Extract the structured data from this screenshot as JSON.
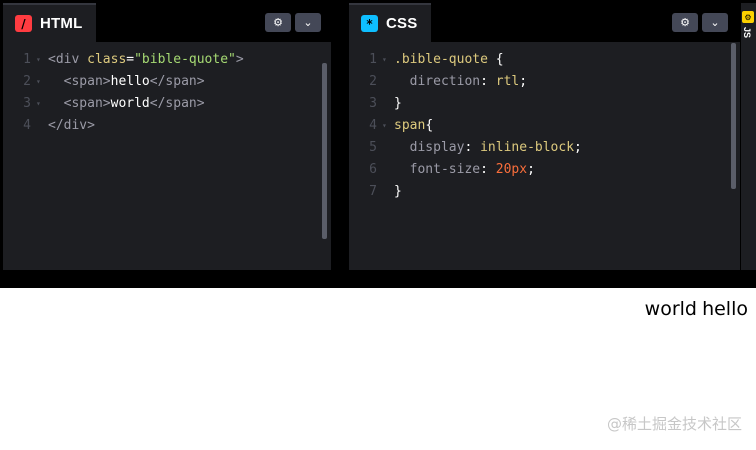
{
  "panes": {
    "html": {
      "label": "HTML",
      "icon": "/",
      "lines": [
        {
          "num": "1",
          "fold": "▾",
          "tokens": [
            {
              "c": "t-tag",
              "t": "<div "
            },
            {
              "c": "t-attr",
              "t": "class"
            },
            {
              "c": "t-punc",
              "t": "="
            },
            {
              "c": "t-str",
              "t": "\"bible-quote\""
            },
            {
              "c": "t-tag",
              "t": ">"
            }
          ]
        },
        {
          "num": "2",
          "fold": "▾",
          "tokens": [
            {
              "c": "t-tag",
              "t": "  <span>"
            },
            {
              "c": "t-text",
              "t": "hello"
            },
            {
              "c": "t-tag",
              "t": "</span>"
            }
          ]
        },
        {
          "num": "3",
          "fold": "▾",
          "tokens": [
            {
              "c": "t-tag",
              "t": "  <span>"
            },
            {
              "c": "t-text",
              "t": "world"
            },
            {
              "c": "t-tag",
              "t": "</span>"
            }
          ]
        },
        {
          "num": "4",
          "fold": "",
          "tokens": [
            {
              "c": "t-tag",
              "t": "</div>"
            }
          ]
        }
      ]
    },
    "css": {
      "label": "CSS",
      "icon": "*",
      "lines": [
        {
          "num": "1",
          "fold": "▾",
          "tokens": [
            {
              "c": "t-sel",
              "t": ".bible-quote "
            },
            {
              "c": "t-punc",
              "t": "{"
            }
          ]
        },
        {
          "num": "2",
          "fold": "",
          "tokens": [
            {
              "c": "t-prop",
              "t": "  direction"
            },
            {
              "c": "t-punc",
              "t": ": "
            },
            {
              "c": "t-kw",
              "t": "rtl"
            },
            {
              "c": "t-punc",
              "t": ";"
            }
          ]
        },
        {
          "num": "3",
          "fold": "",
          "tokens": [
            {
              "c": "t-punc",
              "t": "}"
            }
          ]
        },
        {
          "num": "4",
          "fold": "▾",
          "tokens": [
            {
              "c": "t-sel",
              "t": "span"
            },
            {
              "c": "t-punc",
              "t": "{"
            }
          ]
        },
        {
          "num": "5",
          "fold": "",
          "tokens": [
            {
              "c": "t-prop",
              "t": "  display"
            },
            {
              "c": "t-punc",
              "t": ": "
            },
            {
              "c": "t-kw",
              "t": "inline-block"
            },
            {
              "c": "t-punc",
              "t": ";"
            }
          ]
        },
        {
          "num": "6",
          "fold": "",
          "tokens": [
            {
              "c": "t-prop",
              "t": "  font-size"
            },
            {
              "c": "t-punc",
              "t": ": "
            },
            {
              "c": "t-num",
              "t": "20px"
            },
            {
              "c": "t-punc",
              "t": ";"
            }
          ]
        },
        {
          "num": "7",
          "fold": "",
          "tokens": [
            {
              "c": "t-punc",
              "t": "}"
            }
          ]
        }
      ]
    },
    "js": {
      "label": "JS",
      "icon": "⚙"
    }
  },
  "buttons": {
    "settings_glyph": "⚙",
    "collapse_glyph": "⌄"
  },
  "preview": {
    "spans": [
      "hello",
      "world"
    ]
  },
  "watermark": "@稀土掘金技术社区",
  "colors": {
    "editor_bg": "#1d1e22",
    "chrome_bg": "#000000",
    "html_accent": "#ff3c41",
    "css_accent": "#0ebeff",
    "js_accent": "#fcd000"
  }
}
